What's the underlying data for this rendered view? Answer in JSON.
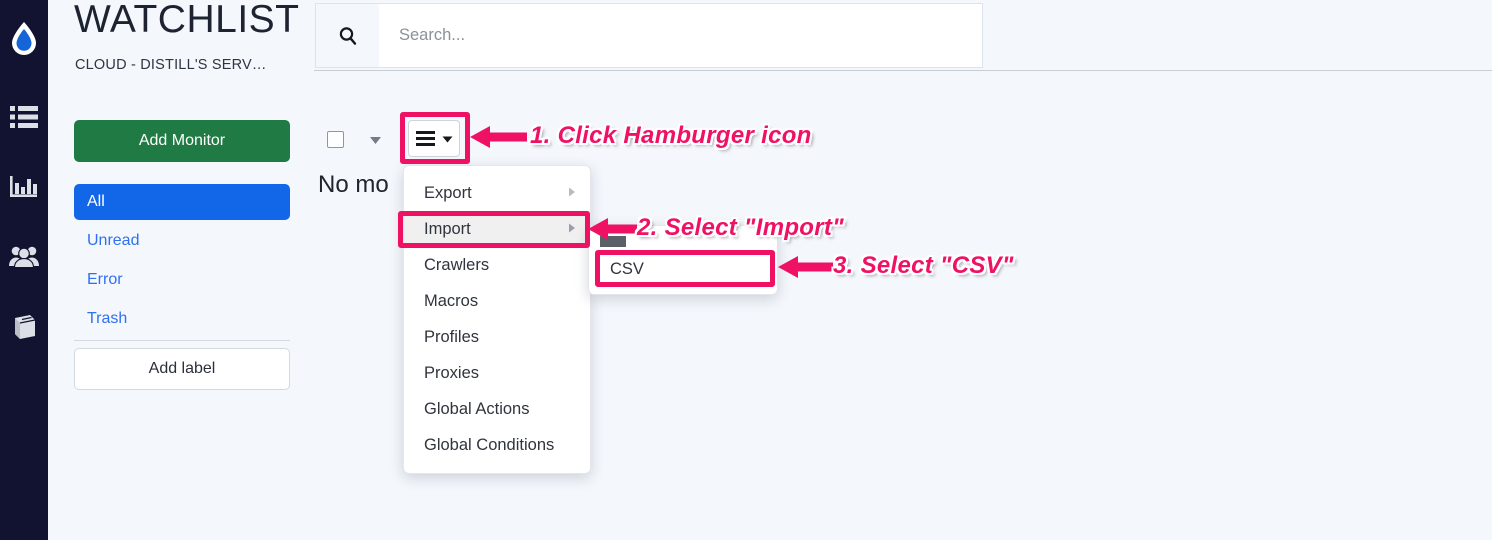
{
  "app": {
    "background_color": "#f4f8fd",
    "rail_color": "#121331",
    "accent_color": "#ef1164",
    "primary_blue": "#1267e8",
    "green": "#1f7a43"
  },
  "rail": {
    "items": [
      {
        "icon": "distill-water-drop-logo-icon",
        "name": "logo"
      },
      {
        "icon": "list-icon",
        "name": "watchlist"
      },
      {
        "icon": "bar-chart-icon",
        "name": "reports"
      },
      {
        "icon": "team-people-icon",
        "name": "team"
      },
      {
        "icon": "book-icon",
        "name": "docs"
      }
    ]
  },
  "sidebar": {
    "title": "WATCHLIST",
    "subtitle": "CLOUD - DISTILL'S SERV…",
    "add_monitor_label": "Add Monitor",
    "filters": [
      {
        "label": "All",
        "active": true
      },
      {
        "label": "Unread",
        "active": false
      },
      {
        "label": "Error",
        "active": false
      },
      {
        "label": "Trash",
        "active": false
      }
    ],
    "add_label_button": "Add label"
  },
  "search": {
    "placeholder": "Search...",
    "value": "",
    "icon": "search-icon"
  },
  "toolbar": {
    "select_all_checked": false,
    "select_caret_icon": "chevron-down-icon",
    "hamburger_icon": "hamburger-icon",
    "hamburger_caret_icon": "caret-down-icon"
  },
  "list": {
    "empty_message": "No mo"
  },
  "menu": {
    "items": [
      {
        "label": "Export",
        "has_submenu": true,
        "highlighted": false
      },
      {
        "label": "Import",
        "has_submenu": true,
        "highlighted": true
      },
      {
        "label": "Crawlers",
        "has_submenu": false,
        "highlighted": false
      },
      {
        "label": "Macros",
        "has_submenu": false,
        "highlighted": false
      },
      {
        "label": "Profiles",
        "has_submenu": false,
        "highlighted": false
      },
      {
        "label": "Proxies",
        "has_submenu": false,
        "highlighted": false
      },
      {
        "label": "Global Actions",
        "has_submenu": false,
        "highlighted": false
      },
      {
        "label": "Global Conditions",
        "has_submenu": false,
        "highlighted": false
      }
    ]
  },
  "submenu": {
    "items": [
      {
        "label": "CSV",
        "highlighted": true
      }
    ]
  },
  "annotations": [
    {
      "id": 1,
      "text": "1. Click Hamburger icon"
    },
    {
      "id": 2,
      "text": "2. Select \"Import\""
    },
    {
      "id": 3,
      "text": "3. Select \"CSV\""
    }
  ]
}
